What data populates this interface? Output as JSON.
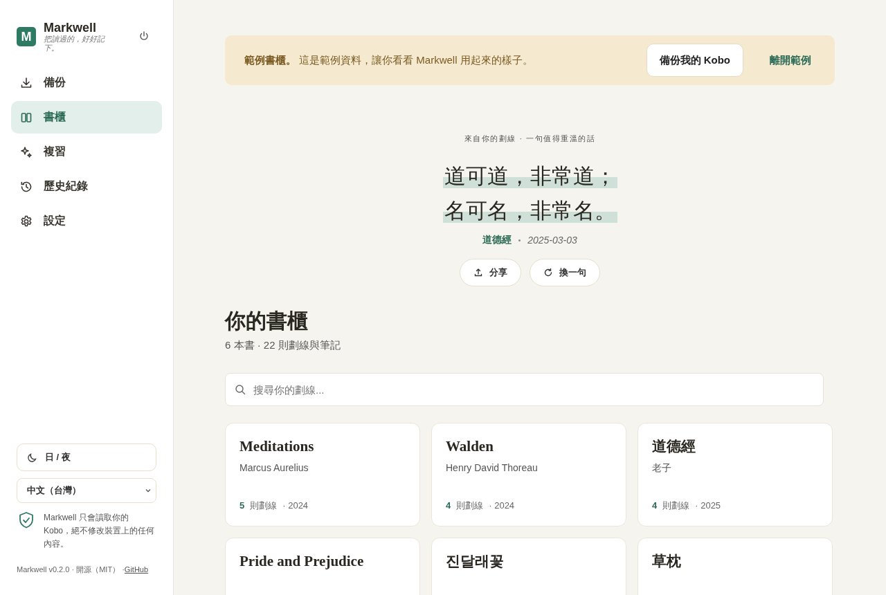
{
  "app": {
    "name": "Markwell",
    "tagline": "把讀過的，好好記下。",
    "logo_letter": "M"
  },
  "nav": [
    {
      "label": "備份",
      "kind": "download",
      "selected": false
    },
    {
      "label": "書櫃",
      "kind": "books",
      "selected": true
    },
    {
      "label": "複習",
      "kind": "sparkle",
      "selected": false
    },
    {
      "label": "歷史紀錄",
      "kind": "history",
      "selected": false
    },
    {
      "label": "設定",
      "kind": "gear",
      "selected": false
    }
  ],
  "theme_button": "日 / 夜",
  "language": "中文（台灣）",
  "privacy_note": "Markwell 只會讀取你的 Kobo，絕不修改裝置上的任何內容。",
  "footer": {
    "text": "Markwell v0.2.0 · 開源（MIT） ·",
    "link": "GitHub"
  },
  "banner": {
    "text": "**範例書櫃。** 這是範例資料，讓你看看 Markwell 用起來的樣子。",
    "primary_button": "備份我的 Kobo",
    "secondary_button": "離開範例"
  },
  "quote": {
    "eyebrow": "來自你的劃線 · 一句值得重溫的話",
    "lines": [
      "道可道，非常道；",
      "名可名，非常名。"
    ],
    "book": "道德經",
    "date": "2025-03-03",
    "buttons": [
      {
        "label": "分享",
        "kind": "share"
      },
      {
        "label": "換一句",
        "kind": "refresh"
      }
    ]
  },
  "shelf": {
    "title": "你的書櫃",
    "summary": "6 本書 · 22 則劃線與筆記",
    "search_placeholder": "搜尋你的劃線...",
    "books": [
      {
        "title": "Meditations",
        "author": "Marcus Aurelius",
        "count": "5",
        "count_label": "則劃線",
        "year": "· 2024"
      },
      {
        "title": "Walden",
        "author": "Henry David Thoreau",
        "count": "4",
        "count_label": "則劃線",
        "year": "· 2024"
      },
      {
        "title": "道德經",
        "author": "老子",
        "count": "4",
        "count_label": "則劃線",
        "year": "· 2025"
      },
      {
        "title": "Pride and Prejudice"
      },
      {
        "title": "진달래꽃"
      },
      {
        "title": "草枕"
      }
    ]
  }
}
